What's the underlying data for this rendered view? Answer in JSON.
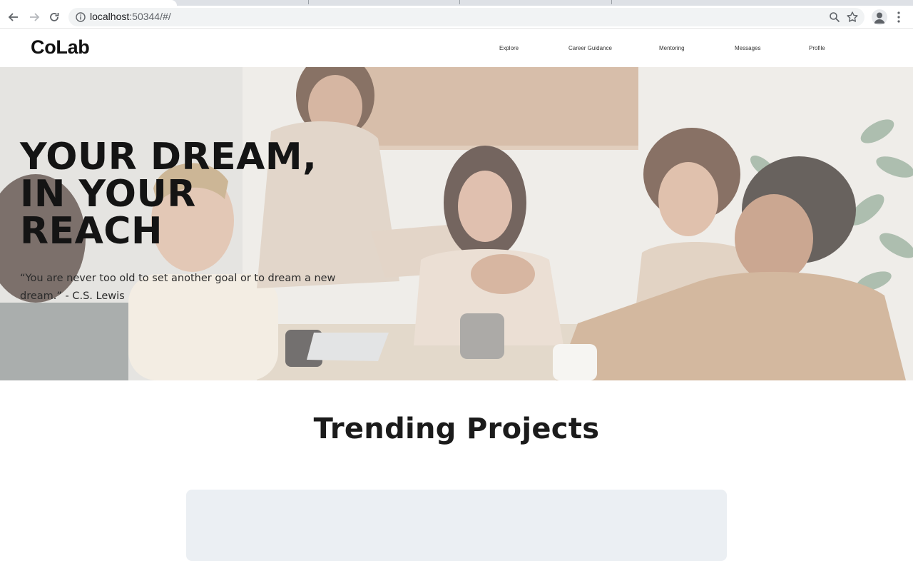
{
  "browser": {
    "url_host": "localhost",
    "url_rest": ":50344/#/",
    "icons": [
      "back-arrow-icon",
      "forward-arrow-icon",
      "reload-icon",
      "info-icon",
      "zoom-icon",
      "star-icon",
      "profile-icon",
      "menu-dots-icon"
    ]
  },
  "header": {
    "logo": "CoLab",
    "nav": [
      "Explore",
      "Career Guidance",
      "Mentoring",
      "Messages",
      "Profile"
    ]
  },
  "hero": {
    "title_lines": [
      "YOUR DREAM,",
      "IN YOUR",
      "REACH"
    ],
    "quote": "“You are never too old to set another goal or to dream a new dream.” - C.S. Lewis"
  },
  "trending": {
    "title": "Trending Projects"
  },
  "colors": {
    "card": "#ebeff3",
    "text": "#141414"
  }
}
